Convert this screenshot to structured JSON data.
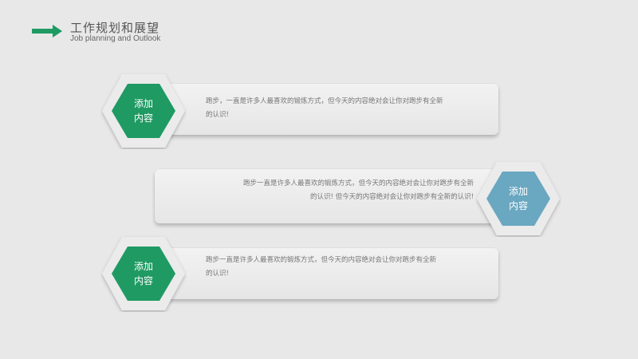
{
  "header": {
    "title": "工作规划和展望",
    "subtitle": "Job planning and Outlook",
    "arrow_color": "#1f9a63"
  },
  "colors": {
    "green": "#1f9a63",
    "blue": "#6aa7c1",
    "hex_outer": "#ebebeb"
  },
  "items": [
    {
      "badge": "添加\n内容",
      "text": "跑步，一直是许多人最喜欢的锻炼方式，但今天的内容绝对会让你对跑步有全新\n的认识!"
    },
    {
      "badge": "添加\n内容",
      "text": "跑步一直是许多人最喜欢的锻炼方式，但今天的内容绝对会让你对跑步有全新\n的认识! 但今天的内容绝对会让你对跑步有全新的认识!"
    },
    {
      "badge": "添加\n内容",
      "text": "跑步一直是许多人最喜欢的锻炼方式，但今天的内容绝对会让你对跑步有全新\n的认识!"
    }
  ]
}
